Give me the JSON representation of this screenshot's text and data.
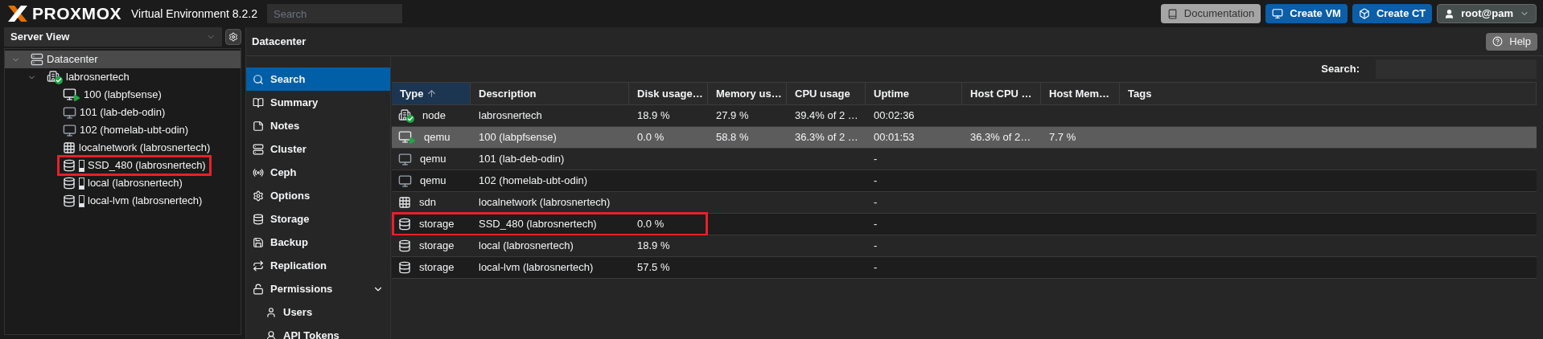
{
  "header": {
    "brand": "PROXMOX",
    "product": "Virtual Environment 8.2.2",
    "search": {
      "placeholder": "Search"
    },
    "buttons": [
      {
        "kind": "doc",
        "label": "Documentation"
      },
      {
        "kind": "vm",
        "label": "Create VM"
      },
      {
        "kind": "ct",
        "label": "Create CT"
      },
      {
        "kind": "user",
        "label": "root@pam"
      }
    ]
  },
  "sidebar": {
    "view": "Server View",
    "tree": [
      {
        "label": "Datacenter",
        "kind": "datacenter",
        "selected": true,
        "expanded": true,
        "children": [
          {
            "label": "labrosnertech",
            "kind": "node",
            "selected": false,
            "expanded": true,
            "children": [
              {
                "label": "100 (labpfsense)",
                "kind": "vm",
                "running": true,
                "selected": false,
                "highlighted": false
              },
              {
                "label": "101 (lab-deb-odin)",
                "kind": "vm",
                "running": false,
                "selected": false,
                "highlighted": false
              },
              {
                "label": "102 (homelab-ubt-odin)",
                "kind": "vm",
                "running": false,
                "selected": false,
                "highlighted": false
              },
              {
                "label": "localnetwork (labrosnertech)",
                "kind": "sdn",
                "selected": false,
                "highlighted": false
              },
              {
                "label": "SSD_480 (labrosnertech)",
                "kind": "storage",
                "selected": false,
                "highlighted": true
              },
              {
                "label": "local (labrosnertech)",
                "kind": "storage",
                "selected": false,
                "highlighted": false
              },
              {
                "label": "local-lvm (labrosnertech)",
                "kind": "storage",
                "selected": false,
                "highlighted": false
              }
            ]
          }
        ]
      }
    ]
  },
  "content": {
    "title": "Datacenter",
    "help": "Help",
    "nav": [
      {
        "label": "Search",
        "selected": true
      },
      {
        "label": "Summary",
        "selected": false
      },
      {
        "label": "Notes",
        "selected": false
      },
      {
        "label": "Cluster",
        "selected": false
      },
      {
        "label": "Ceph",
        "selected": false
      },
      {
        "label": "Options",
        "selected": false
      },
      {
        "label": "Storage",
        "selected": false
      },
      {
        "label": "Backup",
        "selected": false
      },
      {
        "label": "Replication",
        "selected": false
      },
      {
        "label": "Permissions",
        "selected": false,
        "expanded": true,
        "children": [
          {
            "label": "Users",
            "selected": false
          },
          {
            "label": "API Tokens",
            "selected": false
          }
        ]
      }
    ],
    "search_label": "Search:",
    "table": {
      "columns": [
        {
          "label": "Type",
          "sorted": true
        },
        {
          "label": "Description",
          "sorted": false
        },
        {
          "label": "Disk usage…",
          "sorted": false
        },
        {
          "label": "Memory us…",
          "sorted": false
        },
        {
          "label": "CPU usage",
          "sorted": false
        },
        {
          "label": "Uptime",
          "sorted": false
        },
        {
          "label": "Host CPU …",
          "sorted": false
        },
        {
          "label": "Host Mem…",
          "sorted": false
        },
        {
          "label": "Tags",
          "sorted": false
        }
      ],
      "rows": [
        {
          "kind": "node",
          "running": true,
          "selected": false,
          "highlighted": false,
          "cells": [
            "node",
            "labrosnertech",
            "18.9 %",
            "27.9 %",
            "39.4% of 2 …",
            "00:02:36",
            "",
            "",
            ""
          ]
        },
        {
          "kind": "vm",
          "running": true,
          "selected": true,
          "highlighted": false,
          "cells": [
            "qemu",
            "100 (labpfsense)",
            "0.0 %",
            "58.8 %",
            "36.3% of 2 …",
            "00:01:53",
            "36.3% of 2…",
            "7.7 %",
            ""
          ]
        },
        {
          "kind": "vm",
          "running": false,
          "selected": false,
          "highlighted": false,
          "cells": [
            "qemu",
            "101 (lab-deb-odin)",
            "",
            "",
            "",
            "-",
            "",
            "",
            ""
          ]
        },
        {
          "kind": "vm",
          "running": false,
          "selected": false,
          "highlighted": false,
          "cells": [
            "qemu",
            "102 (homelab-ubt-odin)",
            "",
            "",
            "",
            "-",
            "",
            "",
            ""
          ]
        },
        {
          "kind": "sdn",
          "selected": false,
          "highlighted": false,
          "cells": [
            "sdn",
            "localnetwork (labrosnertech)",
            "",
            "",
            "",
            "-",
            "",
            "",
            ""
          ]
        },
        {
          "kind": "storage",
          "selected": false,
          "highlighted": true,
          "cells": [
            "storage",
            "SSD_480 (labrosnertech)",
            "0.0 %",
            "",
            "",
            "-",
            "",
            "",
            ""
          ]
        },
        {
          "kind": "storage",
          "selected": false,
          "highlighted": false,
          "cells": [
            "storage",
            "local (labrosnertech)",
            "18.9 %",
            "",
            "",
            "-",
            "",
            "",
            ""
          ]
        },
        {
          "kind": "storage",
          "selected": false,
          "highlighted": false,
          "cells": [
            "storage",
            "local-lvm (labrosnertech)",
            "57.5 %",
            "",
            "",
            "-",
            "",
            "",
            ""
          ]
        }
      ]
    }
  }
}
